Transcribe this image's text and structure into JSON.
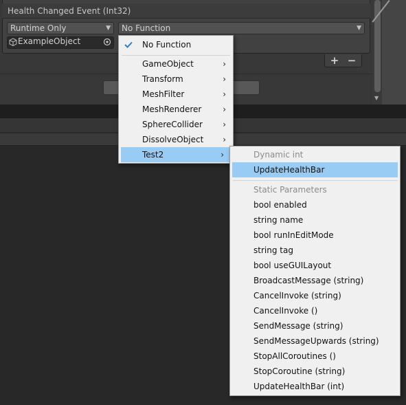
{
  "inspector": {
    "event_title": "Health Changed Event (Int32)",
    "runtime_dropdown": "Runtime Only",
    "function_dropdown": "No Function",
    "object_field": "ExampleObject",
    "plus_label": "+",
    "minus_label": "−"
  },
  "menu": {
    "checked_item": "No Function",
    "items": [
      {
        "label": "GameObject"
      },
      {
        "label": "Transform"
      },
      {
        "label": "MeshFilter"
      },
      {
        "label": "MeshRenderer"
      },
      {
        "label": "SphereCollider"
      },
      {
        "label": "DissolveObject"
      },
      {
        "label": "Test2"
      }
    ],
    "selected": "Test2"
  },
  "submenu": {
    "dynamic_header": "Dynamic int",
    "dynamic_items": [
      {
        "label": "UpdateHealthBar"
      }
    ],
    "static_header": "Static Parameters",
    "static_items": [
      {
        "label": "bool enabled"
      },
      {
        "label": "string name"
      },
      {
        "label": "bool runInEditMode"
      },
      {
        "label": "string tag"
      },
      {
        "label": "bool useGUILayout"
      },
      {
        "label": "BroadcastMessage (string)"
      },
      {
        "label": "CancelInvoke (string)"
      },
      {
        "label": "CancelInvoke ()"
      },
      {
        "label": "SendMessage (string)"
      },
      {
        "label": "SendMessageUpwards (string)"
      },
      {
        "label": "StopAllCoroutines ()"
      },
      {
        "label": "StopCoroutine (string)"
      },
      {
        "label": "UpdateHealthBar (int)"
      }
    ],
    "highlighted": "UpdateHealthBar"
  },
  "colors": {
    "selection": "#99ccf5",
    "menu_bg": "#f0f0f0",
    "editor_bg": "#282828",
    "check": "#2a7fd4"
  }
}
